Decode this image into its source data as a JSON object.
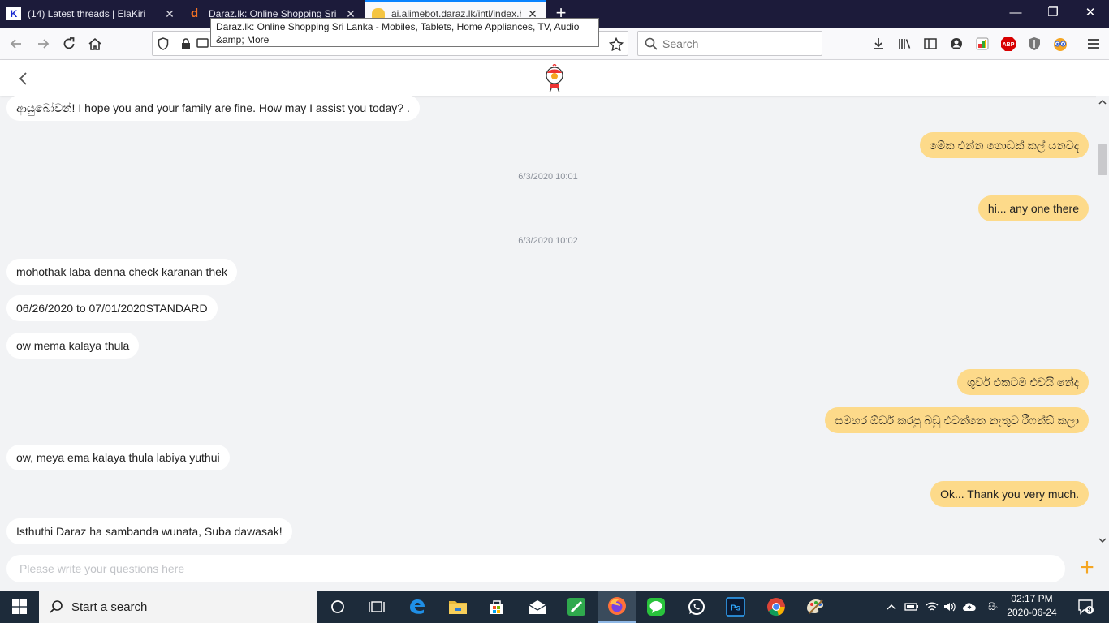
{
  "browser": {
    "tabs": [
      {
        "title": "(14) Latest threads | ElaKiri",
        "active": false
      },
      {
        "title": "Daraz.lk: Online Shopping Sri Lanka - Mobiles, Tablets, Home Appliances, TV, Audio",
        "active": false
      },
      {
        "title": "ai.alimebot.daraz.lk/intl/index.htm",
        "active": true
      }
    ],
    "new_tab_label": "+",
    "tooltip": "Daraz.lk: Online Shopping Sri Lanka - Mobiles, Tablets, Home Appliances, TV, Audio &amp; More",
    "search_placeholder": "Search",
    "window_controls": {
      "minimize": "—",
      "restore": "❐",
      "close": "✕"
    }
  },
  "chat": {
    "messages": [
      {
        "side": "left",
        "text": "ආයුබෝවන්! I hope you and your family are fine. How may I assist you today? ."
      },
      {
        "side": "right",
        "text": "මේක එන්න ගොඩක් කල් යනවද"
      },
      {
        "side": "stamp",
        "text": "6/3/2020 10:01"
      },
      {
        "side": "right",
        "text": "hi... any one there"
      },
      {
        "side": "stamp",
        "text": "6/3/2020 10:02"
      },
      {
        "side": "left",
        "text": "mohothak laba denna check karanan thek"
      },
      {
        "side": "left",
        "text": "06/26/2020 to 07/01/2020STANDARD"
      },
      {
        "side": "left",
        "text": "ow mema kalaya thula"
      },
      {
        "side": "right",
        "text": "ශුවර් එකටම එවයි නේද"
      },
      {
        "side": "right",
        "text": "සමහර ඕඩර් කරපු බඩු එවන්නෙ නැතුව රීෆන්ඩ් කලා"
      },
      {
        "side": "left",
        "text": "ow, meya ema kalaya thula labiya yuthui"
      },
      {
        "side": "right",
        "text": "Ok... Thank you very much."
      },
      {
        "side": "left",
        "text": "Isthuthi Daraz ha sambanda wunata, Suba dawasak!"
      }
    ],
    "input_placeholder": "Please write your questions here",
    "plus_label": "+"
  },
  "taskbar": {
    "search_text": "Start a search",
    "clock_time": "02:17 PM",
    "clock_date": "2020-06-24",
    "lang": "සිං",
    "notif_count": "9"
  },
  "colors": {
    "user_bubble": "#fdda8a",
    "agent_bubble": "#ffffff",
    "accent": "#f5a623"
  }
}
